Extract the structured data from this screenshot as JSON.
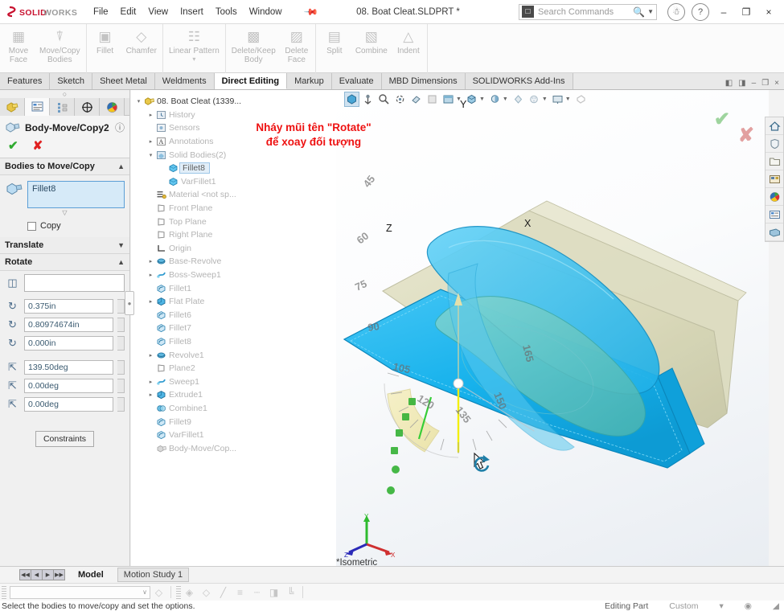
{
  "titlebar": {
    "brand": "SOLIDWORKS",
    "menus": [
      "File",
      "Edit",
      "View",
      "Insert",
      "Tools",
      "Window"
    ],
    "pin_icon": "pin-icon",
    "document_title": "08. Boat Cleat.SLDPRT *",
    "search_placeholder": "Search Commands",
    "search_value": "",
    "account_icon": "account-icon",
    "help_icon": "help-icon",
    "minimize_label": "–",
    "maximize_label": "❐",
    "close_label": "×"
  },
  "ribbon": {
    "groups": [
      {
        "buttons": [
          {
            "label": "Move\nFace",
            "icon": "move-face-icon"
          },
          {
            "label": "Move/Copy\nBodies",
            "icon": "move-copy-bodies-icon"
          }
        ]
      },
      {
        "buttons": [
          {
            "label": "Fillet",
            "icon": "fillet-icon"
          },
          {
            "label": "Chamfer",
            "icon": "chamfer-icon"
          }
        ]
      },
      {
        "buttons": [
          {
            "label": "Linear Pattern",
            "icon": "linear-pattern-icon",
            "dropdown": "▾"
          }
        ]
      },
      {
        "buttons": [
          {
            "label": "Delete/Keep\nBody",
            "icon": "delete-keep-body-icon"
          },
          {
            "label": "Delete\nFace",
            "icon": "delete-face-icon"
          }
        ]
      },
      {
        "buttons": [
          {
            "label": "Split",
            "icon": "split-icon"
          },
          {
            "label": "Combine",
            "icon": "combine-icon"
          },
          {
            "label": "Indent",
            "icon": "indent-icon"
          }
        ]
      }
    ]
  },
  "tabs": {
    "items": [
      {
        "label": "Features",
        "active": false
      },
      {
        "label": "Sketch",
        "active": false
      },
      {
        "label": "Sheet Metal",
        "active": false
      },
      {
        "label": "Weldments",
        "active": false
      },
      {
        "label": "Direct Editing",
        "active": true
      },
      {
        "label": "Markup",
        "active": false
      },
      {
        "label": "Evaluate",
        "active": false
      },
      {
        "label": "MBD Dimensions",
        "active": false
      },
      {
        "label": "SOLIDWORKS Add-Ins",
        "active": false
      }
    ],
    "window_controls": [
      "◧",
      "◨",
      "–",
      "❐",
      "×"
    ]
  },
  "property_manager": {
    "panel_tabs": [
      {
        "name": "feature-manager-tab",
        "icon": "tree-icon",
        "active": false
      },
      {
        "name": "property-manager-tab",
        "icon": "property-icon",
        "active": true
      },
      {
        "name": "configuration-manager-tab",
        "icon": "configuration-icon",
        "active": false
      },
      {
        "name": "dimxpert-manager-tab",
        "icon": "dimxpert-icon",
        "active": false
      },
      {
        "name": "display-manager-tab",
        "icon": "display-icon",
        "active": false
      }
    ],
    "title": "Body-Move/Copy2",
    "help_icon": "help-icon",
    "ok_label": "✔",
    "cancel_label": "✘",
    "bodies_section": {
      "title": "Bodies to Move/Copy",
      "selection_value": "Fillet8",
      "copy_label": "Copy",
      "copy_checked": false
    },
    "translate_section": {
      "title": "Translate"
    },
    "rotate_section": {
      "title": "Rotate",
      "reference_value": "",
      "fields": [
        {
          "icon": "rotate-origin-x-icon",
          "value": "0.375in"
        },
        {
          "icon": "rotate-origin-y-icon",
          "value": "0.80974674in"
        },
        {
          "icon": "rotate-origin-z-icon",
          "value": "0.000in"
        },
        {
          "icon": "rotate-angle-x-icon",
          "value": "139.50deg"
        },
        {
          "icon": "rotate-angle-y-icon",
          "value": "0.00deg"
        },
        {
          "icon": "rotate-angle-z-icon",
          "value": "0.00deg"
        }
      ]
    },
    "constraints_label": "Constraints"
  },
  "feature_tree": {
    "items": [
      {
        "label": "08. Boat Cleat  (1339...",
        "indent": 0,
        "arrow": "▾",
        "icon": "part-icon",
        "state": "root"
      },
      {
        "label": "History",
        "indent": 1,
        "arrow": "▸",
        "icon": "history-icon",
        "state": "dim"
      },
      {
        "label": "Sensors",
        "indent": 1,
        "arrow": "",
        "icon": "sensors-icon",
        "state": "dim"
      },
      {
        "label": "Annotations",
        "indent": 1,
        "arrow": "▸",
        "icon": "annotations-icon",
        "state": "dim"
      },
      {
        "label": "Solid Bodies(2)",
        "indent": 1,
        "arrow": "▾",
        "icon": "solid-bodies-icon",
        "state": "dim"
      },
      {
        "label": "Fillet8",
        "indent": 2,
        "arrow": "",
        "icon": "body-icon",
        "state": "selected"
      },
      {
        "label": "VarFillet1",
        "indent": 2,
        "arrow": "",
        "icon": "body-icon",
        "state": "dim"
      },
      {
        "label": "Material <not sp...",
        "indent": 1,
        "arrow": "",
        "icon": "material-icon",
        "state": "dim"
      },
      {
        "label": "Front Plane",
        "indent": 1,
        "arrow": "",
        "icon": "plane-icon",
        "state": "dim"
      },
      {
        "label": "Top Plane",
        "indent": 1,
        "arrow": "",
        "icon": "plane-icon",
        "state": "dim"
      },
      {
        "label": "Right Plane",
        "indent": 1,
        "arrow": "",
        "icon": "plane-icon",
        "state": "dim"
      },
      {
        "label": "Origin",
        "indent": 1,
        "arrow": "",
        "icon": "origin-icon",
        "state": "dim"
      },
      {
        "label": "Base-Revolve",
        "indent": 1,
        "arrow": "▸",
        "icon": "revolve-icon",
        "state": "dim"
      },
      {
        "label": "Boss-Sweep1",
        "indent": 1,
        "arrow": "▸",
        "icon": "sweep-icon",
        "state": "dim"
      },
      {
        "label": "Fillet1",
        "indent": 1,
        "arrow": "",
        "icon": "fillet-feature-icon",
        "state": "dim"
      },
      {
        "label": "Flat Plate",
        "indent": 1,
        "arrow": "▸",
        "icon": "extrude-icon",
        "state": "dim"
      },
      {
        "label": "Fillet6",
        "indent": 1,
        "arrow": "",
        "icon": "fillet-feature-icon",
        "state": "dim"
      },
      {
        "label": "Fillet7",
        "indent": 1,
        "arrow": "",
        "icon": "fillet-feature-icon",
        "state": "dim"
      },
      {
        "label": "Fillet8",
        "indent": 1,
        "arrow": "",
        "icon": "fillet-feature-icon",
        "state": "dim"
      },
      {
        "label": "Revolve1",
        "indent": 1,
        "arrow": "▸",
        "icon": "revolve-icon",
        "state": "dim"
      },
      {
        "label": "Plane2",
        "indent": 1,
        "arrow": "",
        "icon": "plane-icon",
        "state": "dim"
      },
      {
        "label": "Sweep1",
        "indent": 1,
        "arrow": "▸",
        "icon": "sweep-icon",
        "state": "dim"
      },
      {
        "label": "Extrude1",
        "indent": 1,
        "arrow": "▸",
        "icon": "extrude-icon",
        "state": "dim"
      },
      {
        "label": "Combine1",
        "indent": 1,
        "arrow": "",
        "icon": "combine-feature-icon",
        "state": "dim"
      },
      {
        "label": "Fillet9",
        "indent": 1,
        "arrow": "",
        "icon": "fillet-feature-icon",
        "state": "dim"
      },
      {
        "label": "VarFillet1",
        "indent": 1,
        "arrow": "",
        "icon": "fillet-feature-icon",
        "state": "dim"
      },
      {
        "label": "Body-Move/Cop...",
        "indent": 1,
        "arrow": "",
        "icon": "body-move-icon",
        "state": "dim"
      }
    ]
  },
  "annotation": {
    "line1": "Nháy mũi tên \"Rotate\"",
    "line2": "để xoay đối tượng",
    "color": "#ee1111"
  },
  "viewport": {
    "toolbar": [
      {
        "name": "zoom-to-fit-icon",
        "glyph": "⬡",
        "active": true
      },
      {
        "name": "zoom-to-area-icon",
        "glyph": "⚓",
        "active": false
      },
      {
        "name": "zoom-in-out-icon",
        "glyph": "🔍",
        "active": false
      },
      {
        "name": "rotate-view-icon",
        "glyph": "✲",
        "active": false
      },
      {
        "name": "pan-icon",
        "glyph": "✋",
        "active": false
      },
      {
        "name": "previous-view-icon",
        "glyph": "◫",
        "active": false
      },
      {
        "name": "section-view-icon",
        "glyph": "▤",
        "active": false,
        "dropdown": "▾"
      },
      {
        "name": "view-orientation-icon",
        "glyph": "⬛",
        "active": false,
        "dropdown": "▾"
      },
      {
        "name": "display-style-icon",
        "glyph": "◔",
        "active": false,
        "dropdown": "▾"
      },
      {
        "name": "hide-show-items-icon",
        "glyph": "◈",
        "active": false
      },
      {
        "name": "edit-appearance-icon",
        "glyph": "◕",
        "active": false,
        "dropdown": "▾"
      },
      {
        "name": "apply-scene-icon",
        "glyph": "▣",
        "active": false,
        "dropdown": "▾"
      },
      {
        "name": "view-settings-icon",
        "glyph": "⬚",
        "active": false
      }
    ],
    "view_label": "*Isometric",
    "triad": {
      "x": "X",
      "y": "Y",
      "z": "Z"
    },
    "axis_labels": {
      "x": "X",
      "y": "Y",
      "z": "Z"
    },
    "protractor_ticks": [
      "45",
      "60",
      "75",
      "90",
      "105",
      "120",
      "135",
      "150",
      "165"
    ],
    "cursor": "rotate-cursor",
    "confirm_ok": "✔",
    "confirm_cancel": "✘"
  },
  "right_toolbar": {
    "buttons": [
      {
        "name": "home-icon",
        "glyph": "⌂"
      },
      {
        "name": "design-library-icon",
        "glyph": "⛉"
      },
      {
        "name": "file-explorer-icon",
        "glyph": "🗀"
      },
      {
        "name": "view-palette-icon",
        "glyph": "▥"
      },
      {
        "name": "appearances-icon",
        "glyph": "◔"
      },
      {
        "name": "custom-properties-icon",
        "glyph": "▤"
      },
      {
        "name": "3d-views-icon",
        "glyph": "▰"
      }
    ]
  },
  "bottom": {
    "nav_buttons": [
      "◀◀",
      "◀",
      "▶",
      "▶▶"
    ],
    "tabs": [
      {
        "label": "Model",
        "active": true
      },
      {
        "label": "Motion Study 1",
        "active": false
      }
    ],
    "toolbar2": {
      "combo_value": "",
      "combo_caret": "∨",
      "buttons": [
        {
          "name": "shaded-sketch-contours-icon",
          "glyph": "◇"
        },
        {
          "name": "quick-snaps-icon",
          "glyph": "◈"
        },
        {
          "name": "line-format-icon",
          "glyph": "╱"
        },
        {
          "name": "line-thickness-icon",
          "glyph": "≡"
        },
        {
          "name": "line-style-icon",
          "glyph": "┈"
        },
        {
          "name": "color-display-mode-icon",
          "glyph": "◨"
        },
        {
          "name": "layer-properties-icon",
          "glyph": "╚"
        }
      ]
    },
    "status_message": "Select the bodies to move/copy and set the options.",
    "edit_mode": "Editing Part",
    "units": "Custom",
    "units_caret": "▾"
  }
}
